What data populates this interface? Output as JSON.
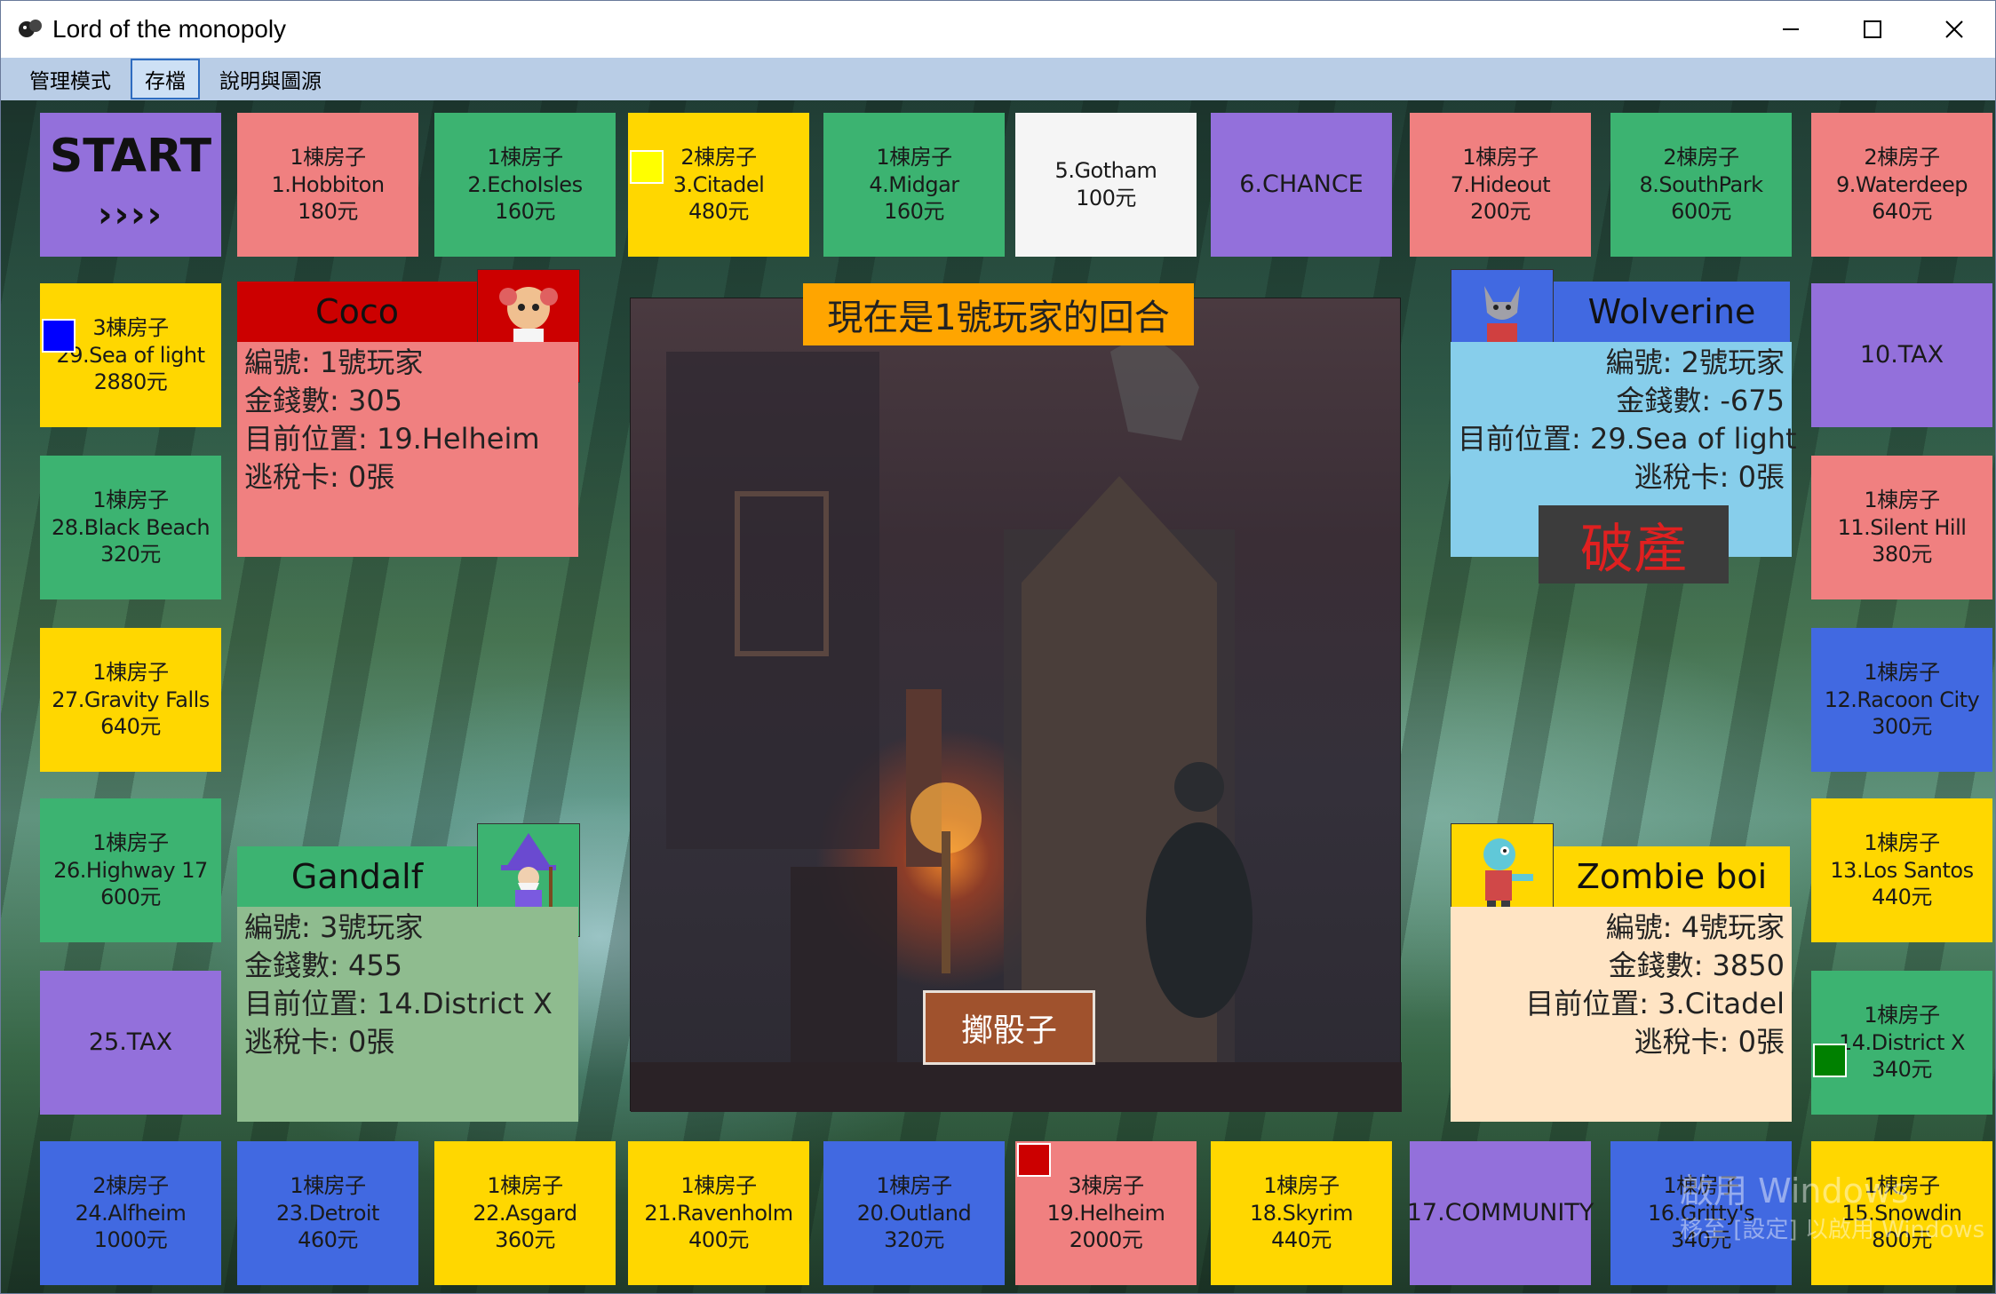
{
  "window": {
    "title": "Lord of the monopoly",
    "icon": "game-controller-icon"
  },
  "menu": [
    "管理模式",
    "存檔",
    "說明與圖源"
  ],
  "menu_active": "存檔",
  "tiles": {
    "start": {
      "title": "START",
      "arrows": "››››"
    },
    "t1": {
      "house": "1棟房子",
      "name": "1.Hobbiton",
      "price": "180元"
    },
    "t2": {
      "house": "1棟房子",
      "name": "2.EchoIsles",
      "price": "160元"
    },
    "t3": {
      "house": "2棟房子",
      "name": "3.Citadel",
      "price": "480元"
    },
    "t4": {
      "house": "1棟房子",
      "name": "4.Midgar",
      "price": "160元"
    },
    "t5": {
      "name": "5.Gotham",
      "price": "100元"
    },
    "t6": {
      "name": "6.CHANCE"
    },
    "t7": {
      "house": "1棟房子",
      "name": "7.Hideout",
      "price": "200元"
    },
    "t8": {
      "house": "2棟房子",
      "name": "8.SouthPark",
      "price": "600元"
    },
    "t9": {
      "house": "2棟房子",
      "name": "9.Waterdeep",
      "price": "640元"
    },
    "t10": {
      "name": "10.TAX"
    },
    "t11": {
      "house": "1棟房子",
      "name": "11.Silent Hill",
      "price": "380元"
    },
    "t12": {
      "house": "1棟房子",
      "name": "12.Racoon City",
      "price": "300元"
    },
    "t13": {
      "house": "1棟房子",
      "name": "13.Los Santos",
      "price": "440元"
    },
    "t14": {
      "house": "1棟房子",
      "name": "14.District X",
      "price": "340元"
    },
    "t15": {
      "house": "1棟房子",
      "name": "15.Snowdin",
      "price": "800元"
    },
    "t16": {
      "house": "1棟房子",
      "name": "16.Gritty's",
      "price": "340元"
    },
    "t17": {
      "name": "17.COMMUNITY"
    },
    "t18": {
      "house": "1棟房子",
      "name": "18.Skyrim",
      "price": "440元"
    },
    "t19": {
      "house": "3棟房子",
      "name": "19.Helheim",
      "price": "2000元"
    },
    "t20": {
      "house": "1棟房子",
      "name": "20.Outland",
      "price": "320元"
    },
    "t21": {
      "house": "1棟房子",
      "name": "21.Ravenholm",
      "price": "400元"
    },
    "t22": {
      "house": "1棟房子",
      "name": "22.Asgard",
      "price": "360元"
    },
    "t23": {
      "house": "1棟房子",
      "name": "23.Detroit",
      "price": "460元"
    },
    "t24": {
      "house": "2棟房子",
      "name": "24.Alfheim",
      "price": "1000元"
    },
    "t25": {
      "name": "25.TAX"
    },
    "t26": {
      "house": "1棟房子",
      "name": "26.Highway 17",
      "price": "600元"
    },
    "t27": {
      "house": "1棟房子",
      "name": "27.Gravity Falls",
      "price": "640元"
    },
    "t28": {
      "house": "1棟房子",
      "name": "28.Black Beach",
      "price": "320元"
    },
    "t29": {
      "house": "3棟房子",
      "name": "29.Sea of light",
      "price": "2880元"
    }
  },
  "markers": {
    "yellow": "#ffff00",
    "blue": "#0000ff",
    "green": "#008000",
    "red": "#cc0000"
  },
  "players": [
    {
      "name": "Coco",
      "id": "編號: 1號玩家",
      "money": "金錢數: 305",
      "pos": "目前位置: 19.Helheim",
      "card": "逃稅卡: 0張",
      "color": "#f08080",
      "head_color": "#cc0000",
      "avatar": "monkey-avatar-icon"
    },
    {
      "name": "Wolverine",
      "id": "編號: 2號玩家",
      "money": "金錢數: -675",
      "pos": "目前位置: 29.Sea of light",
      "card": "逃稅卡: 0張",
      "color": "#87ceeb",
      "head_color": "#4169e1",
      "avatar": "wolf-avatar-icon"
    },
    {
      "name": "Gandalf",
      "id": "編號: 3號玩家",
      "money": "金錢數: 455",
      "pos": "目前位置: 14.District X",
      "card": "逃稅卡: 0張",
      "color": "#8fbc8f",
      "head_color": "#3cb371",
      "avatar": "wizard-avatar-icon"
    },
    {
      "name": "Zombie boi",
      "id": "編號: 4號玩家",
      "money": "金錢數: 3850",
      "pos": "目前位置: 3.Citadel",
      "card": "逃稅卡: 0張",
      "color": "#ffe4c4",
      "head_color": "#ffd700",
      "avatar": "zombie-avatar-icon"
    }
  ],
  "turn_banner": "現在是1號玩家的回合",
  "roll_button": "擲骰子",
  "bankrupt_label": "破產",
  "watermark": {
    "line1": "啟用 Windows",
    "line2": "移至 [設定] 以啟用 Windows"
  }
}
